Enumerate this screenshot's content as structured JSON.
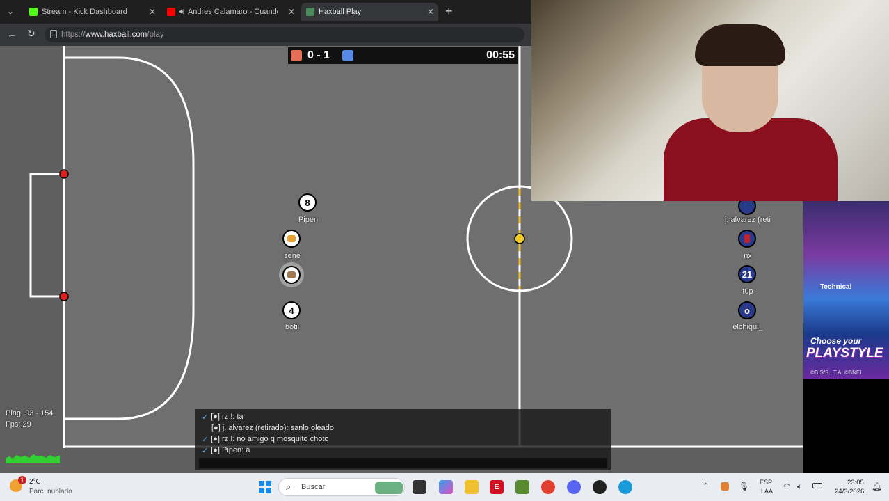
{
  "browser": {
    "tabs": [
      {
        "label": "Stream - Kick Dashboard",
        "color": "#53fc18"
      },
      {
        "label": "Andres Calamaro - Cuando te",
        "color": "#ff0000"
      },
      {
        "label": "Haxball Play",
        "color": "#4a8a5a"
      }
    ],
    "url_prefix": "https://",
    "url_domain": "www.haxball.com",
    "url_path": "/play"
  },
  "game": {
    "score": "0 - 1",
    "red_color": "#e56e56",
    "blue_color": "#5689e5",
    "time": "00:55",
    "players": [
      {
        "avatar": "8",
        "name": "Pipen",
        "team": "red"
      },
      {
        "avatar": "",
        "name": "sene",
        "team": "red"
      },
      {
        "avatar": "",
        "name": "",
        "team": "red"
      },
      {
        "avatar": "4",
        "name": "botii",
        "team": "red"
      },
      {
        "avatar": "",
        "name": "j. alvarez (reti",
        "team": "blue"
      },
      {
        "avatar": "",
        "name": "nx",
        "team": "blue"
      },
      {
        "avatar": "21",
        "name": "t0p",
        "team": "blue"
      },
      {
        "avatar": "o",
        "name": "elchiqui_",
        "team": "blue"
      }
    ],
    "ping": "Ping: 93 - 154",
    "fps": "Fps: 29"
  },
  "chat": {
    "messages": [
      "[●] rz !: ta",
      "[●] j. alvarez (retirado): sanlo oleado",
      "[●] rz !: no amigo q mosquito choto",
      "[●] Pipen: a"
    ]
  },
  "ad": {
    "tag": "Technical",
    "headline1": "Choose your",
    "headline2": "PLAYSTYLE",
    "credit": "©B.S/S., T.A. ©BNEI"
  },
  "taskbar": {
    "weather_temp": "2°C",
    "weather_desc": "Parc. nublado",
    "weather_badge": "1",
    "search_label": "Buscar",
    "lang1": "ESP",
    "lang2": "LAA",
    "time": "23:05",
    "date": "24/3/2026"
  }
}
